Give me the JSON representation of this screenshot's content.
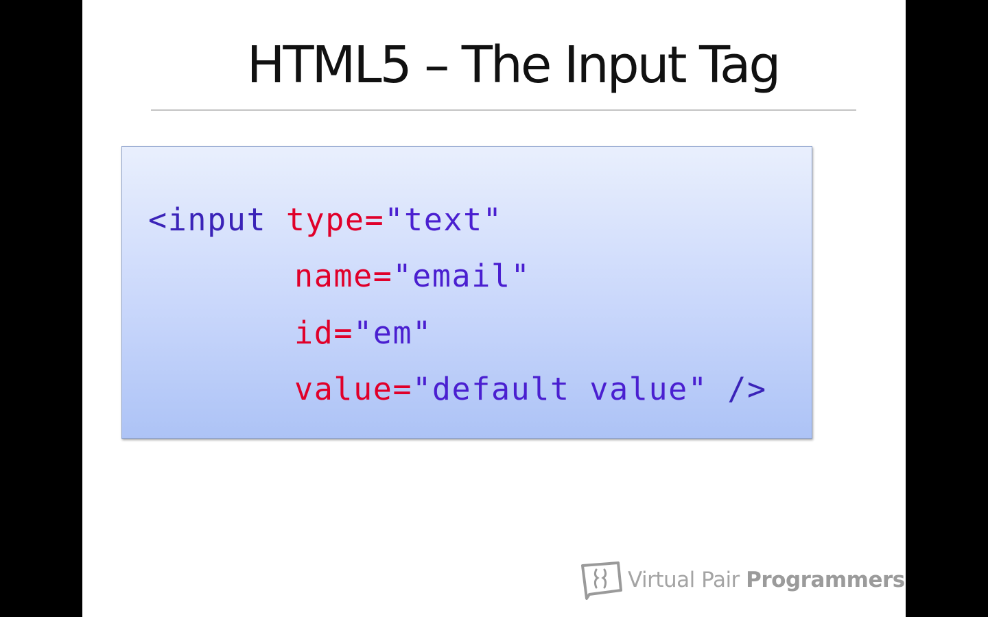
{
  "slide": {
    "title": "HTML5 – The Input Tag"
  },
  "code": {
    "line1": {
      "open": "<input",
      "attr": "type",
      "eq": "=",
      "value": "\"text\""
    },
    "line2": {
      "attr": "name",
      "eq": "=",
      "value": "\"email\""
    },
    "line3": {
      "attr": "id",
      "eq": "=",
      "value": "\"em\""
    },
    "line4": {
      "attr": "value",
      "eq": "=",
      "value": "\"default value\"",
      "close": "/>"
    }
  },
  "brand": {
    "name_light": "Virtual Pair ",
    "name_bold": "Programmers",
    "logo_icon": "speech-bubbles-logo-icon"
  },
  "colors": {
    "tag": "#a0153e",
    "attribute": "#e0002a",
    "value": "#4a1fd0",
    "box_top": "#e9effd",
    "box_bottom": "#adc3f6"
  }
}
